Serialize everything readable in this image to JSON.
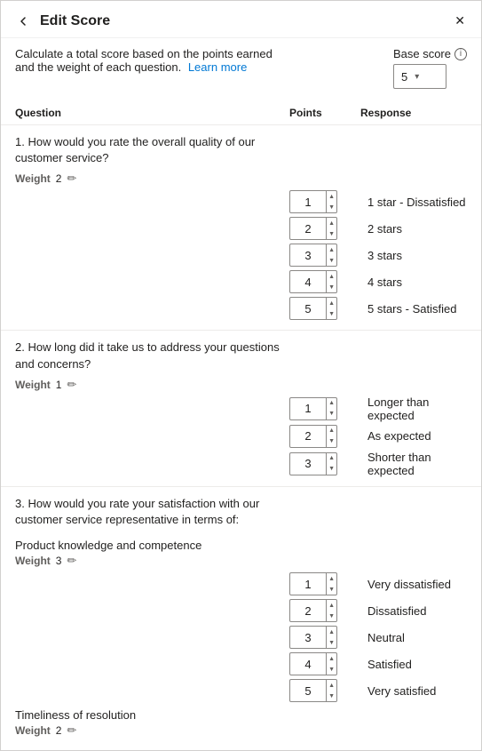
{
  "header": {
    "title": "Edit Score",
    "back_label": "←",
    "close_label": "✕"
  },
  "description": {
    "text": "Calculate a total score based on the points earned and the weight of each question.",
    "link_text": "Learn more"
  },
  "base_score": {
    "label": "Base score",
    "value": "5"
  },
  "table": {
    "columns": [
      "Question",
      "Points",
      "Response"
    ]
  },
  "questions": [
    {
      "id": "q1",
      "text": "1. How would you rate the overall quality of our customer service?",
      "weight_label": "Weight",
      "weight_value": "2",
      "sub_labels": [],
      "response_rows": [
        {
          "points": "1",
          "response": "1 star - Dissatisfied"
        },
        {
          "points": "2",
          "response": "2 stars"
        },
        {
          "points": "3",
          "response": "3 stars"
        },
        {
          "points": "4",
          "response": "4 stars"
        },
        {
          "points": "5",
          "response": "5 stars - Satisfied"
        }
      ]
    },
    {
      "id": "q2",
      "text": "2. How long did it take us to address your questions and concerns?",
      "weight_label": "Weight",
      "weight_value": "1",
      "sub_labels": [],
      "response_rows": [
        {
          "points": "1",
          "response": "Longer than expected"
        },
        {
          "points": "2",
          "response": "As expected"
        },
        {
          "points": "3",
          "response": "Shorter than expected"
        }
      ]
    },
    {
      "id": "q3",
      "text": "3. How would you rate your satisfaction with our customer service representative in terms of:",
      "weight_label": null,
      "weight_value": null,
      "sub_labels": [
        {
          "label": "Product knowledge and competence",
          "weight_label": "Weight",
          "weight_value": "3"
        },
        {
          "label": "Timeliness of resolution",
          "weight_label": "Weight",
          "weight_value": "2"
        }
      ],
      "response_rows": [
        {
          "points": "1",
          "response": "Very dissatisfied"
        },
        {
          "points": "2",
          "response": "Dissatisfied"
        },
        {
          "points": "3",
          "response": "Neutral"
        },
        {
          "points": "4",
          "response": "Satisfied"
        },
        {
          "points": "5",
          "response": "Very satisfied"
        }
      ]
    }
  ]
}
